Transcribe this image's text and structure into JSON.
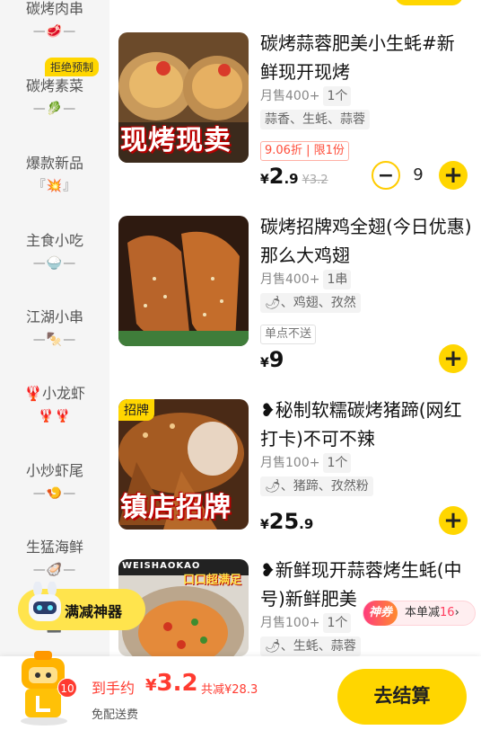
{
  "sidebar": {
    "categories": [
      {
        "label": "碳烤肉串",
        "deco": "—🥩—"
      },
      {
        "label": "碳烤素菜",
        "deco": "—🥬—",
        "badge": "拒绝预制"
      },
      {
        "label": "爆款新品",
        "deco": "『💥』"
      },
      {
        "label": "主食小吃",
        "deco": "—🍚—"
      },
      {
        "label": "江湖小串",
        "deco": "—🍢—"
      },
      {
        "label": "🦞小龙虾",
        "deco": "🦞🦞"
      },
      {
        "label": "小炒虾尾",
        "deco": "—🍤—"
      },
      {
        "label": "生猛海鲜",
        "deco": "—🦪—"
      },
      {
        "label": "",
        "deco": "—🍱—"
      }
    ]
  },
  "products": [
    {
      "title": "碳烤蒜蓉肥美小生蚝#新鲜现开现烤",
      "sales": "月售400+",
      "unit": "1个",
      "ingredients": "蒜香、生蚝、蒜蓉",
      "discount": "9.06折 | 限1份",
      "price_currency": "¥",
      "price_int": "2",
      "price_dec": ".9",
      "price_orig": "¥3.2",
      "quantity": "9",
      "image_overlay": "现烤现卖"
    },
    {
      "title": "碳烤招牌鸡全翅(今日优惠)那么大鸡翅",
      "sales": "月售400+",
      "unit": "1串",
      "ingredients": "🌶、鸡翅、孜然",
      "note": "单点不送",
      "price_currency": "¥",
      "price_int": "9",
      "price_dec": ""
    },
    {
      "title": "❥秘制软糯碳烤猪蹄(网红打卡)不可不辣",
      "sales": "月售100+",
      "unit": "1个",
      "ingredients": "🌶、猪蹄、孜然粉",
      "price_currency": "¥",
      "price_int": "25",
      "price_dec": ".9",
      "image_tag": "招牌",
      "image_overlay": "镇店招牌"
    },
    {
      "title": "❥新鲜现开蒜蓉烤生蚝(中号)新鲜肥美",
      "sales": "月售100+",
      "unit": "1个",
      "ingredients": "🌶、生蚝、蒜蓉",
      "image_banner": "WEISHAOKAO",
      "image_overlay": "口口超满足"
    }
  ],
  "promo": {
    "label": "满减神器"
  },
  "recommend": {
    "tag": "神券",
    "text": "本单减",
    "amount": "16",
    "arrow": "›"
  },
  "bottom": {
    "cart_count": "10",
    "total_label": "到手约",
    "total_currency": "¥",
    "total_value": "3.2",
    "saved": "共减¥28.3",
    "delivery": "免配送费",
    "checkout": "去结算"
  },
  "colors": {
    "accent": "#ffd600",
    "price_red": "#ff3b30",
    "sidebar_bg": "#f5f5f5"
  }
}
